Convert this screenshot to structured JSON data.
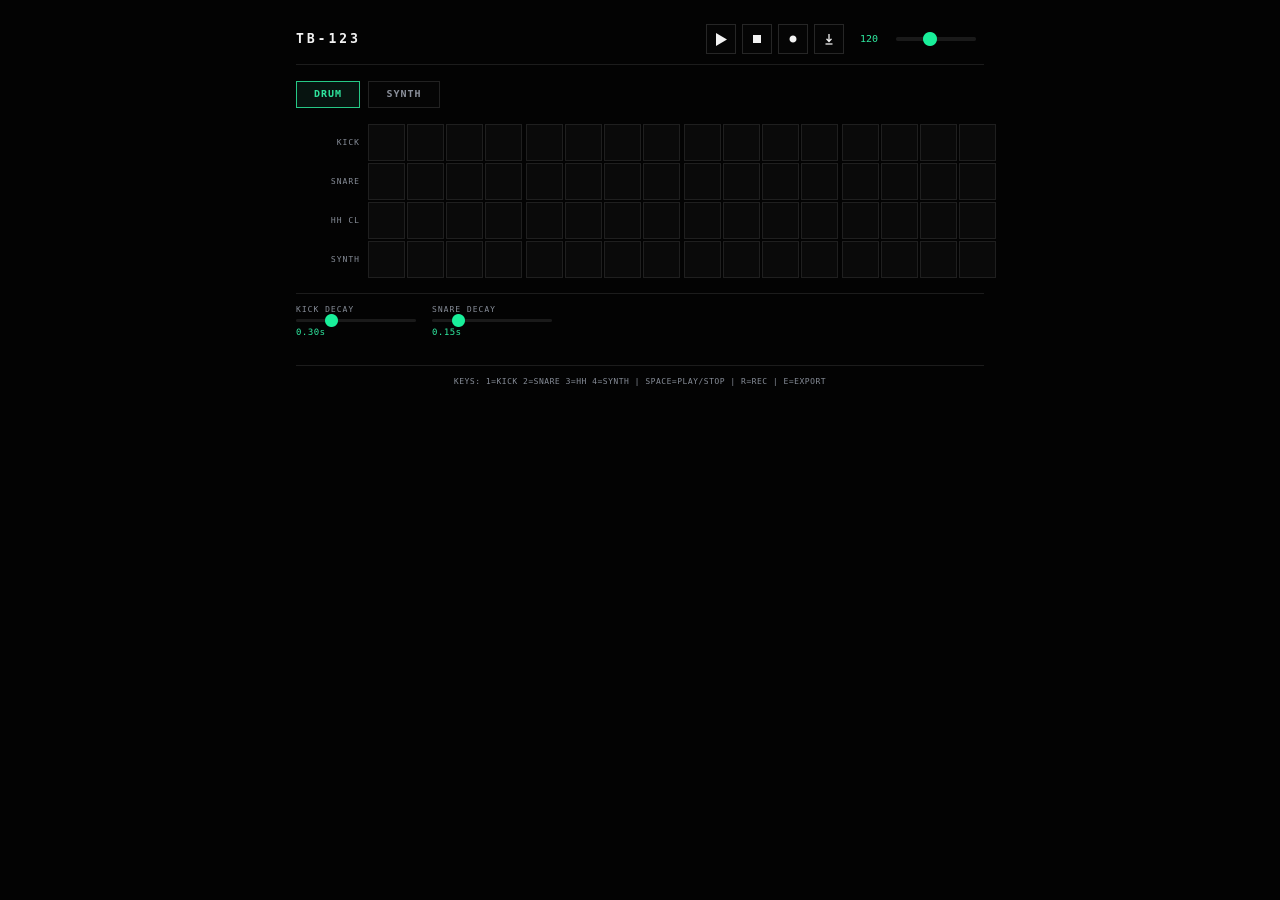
{
  "app": {
    "title": "TB-123"
  },
  "transport": {
    "play_icon": "play-icon",
    "stop_icon": "stop-icon",
    "record_icon": "record-icon",
    "export_icon": "download-icon",
    "bpm": "120",
    "bpm_level": 0.43,
    "accent": "#19ef9a"
  },
  "tabs": [
    {
      "label": "DRUM",
      "active": true
    },
    {
      "label": "SYNTH",
      "active": false
    }
  ],
  "grid": {
    "steps_per_row": 16,
    "rows": [
      {
        "label": "KICK"
      },
      {
        "label": "SNARE"
      },
      {
        "label": "HH CL"
      },
      {
        "label": "SYNTH"
      }
    ]
  },
  "params": [
    {
      "label": "KICK DECAY",
      "value": "0.30s",
      "level": 0.29
    },
    {
      "label": "SNARE DECAY",
      "value": "0.15s",
      "level": 0.22
    }
  ],
  "footer": {
    "text": "KEYS: 1=KICK 2=SNARE 3=HH 4=SYNTH | SPACE=PLAY/STOP | R=REC | E=EXPORT"
  }
}
